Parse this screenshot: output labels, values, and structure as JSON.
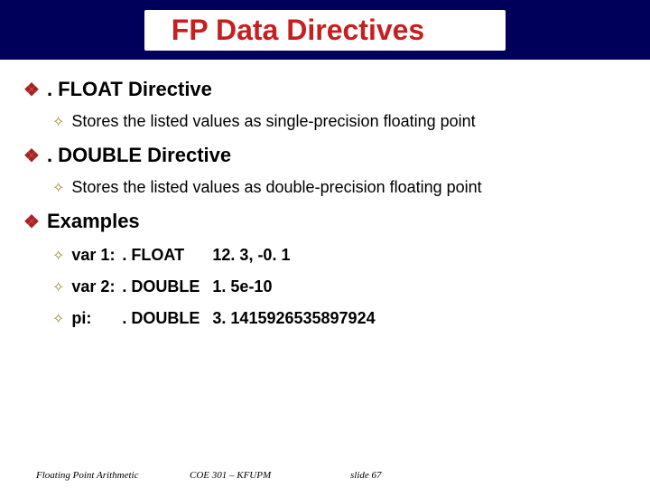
{
  "title": "FP Data Directives",
  "floatDirective": {
    "heading": ". FLOAT Directive",
    "desc": "Stores the listed values as single-precision floating point"
  },
  "doubleDirective": {
    "heading": ". DOUBLE Directive",
    "desc": "Stores the listed values as double-precision floating point"
  },
  "examples": {
    "heading": "Examples",
    "rows": [
      {
        "name": "var 1:",
        "dir": ". FLOAT",
        "vals": "12. 3, -0. 1"
      },
      {
        "name": "var 2:",
        "dir": ". DOUBLE",
        "vals": "1. 5e-10"
      },
      {
        "name": "pi:",
        "dir": ". DOUBLE",
        "vals": "3. 1415926535897924"
      }
    ]
  },
  "footer": {
    "left": "Floating Point Arithmetic",
    "center": "COE 301 – KFUPM",
    "right": "slide 67"
  }
}
